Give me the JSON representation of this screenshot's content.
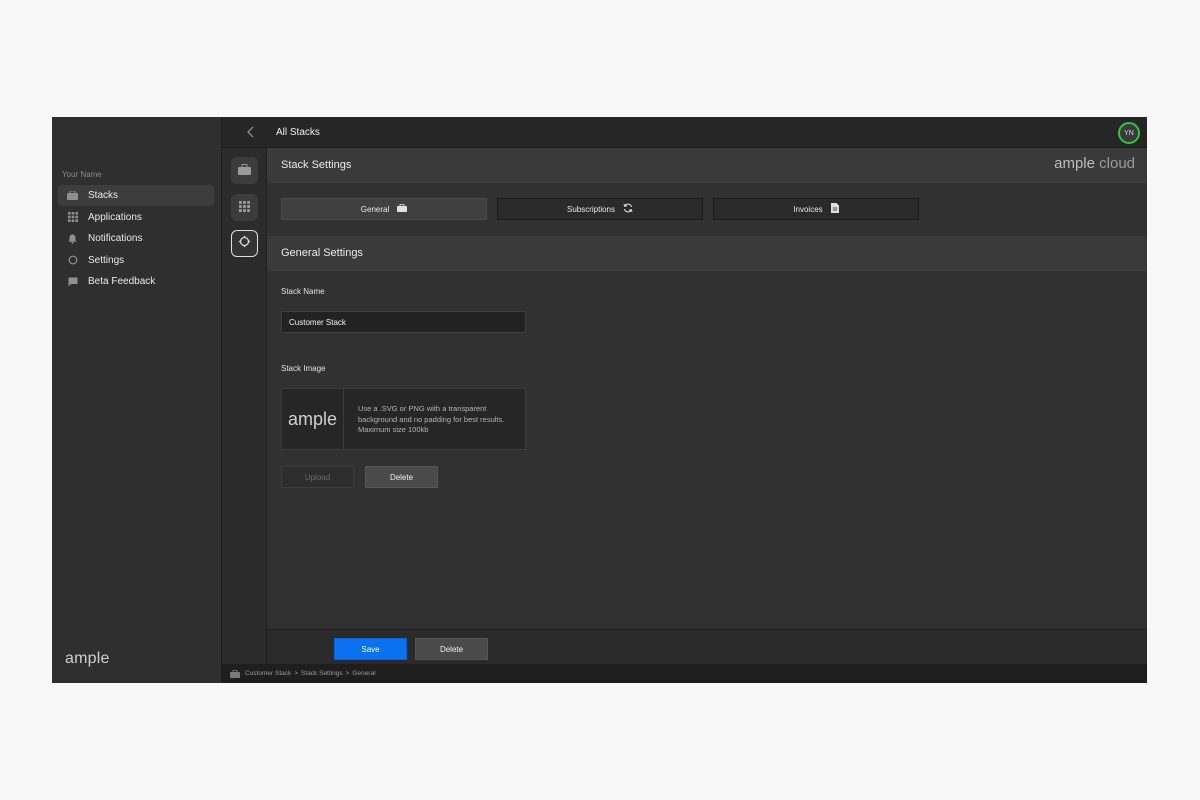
{
  "sidebar": {
    "user_name": "Your Name",
    "items": [
      {
        "label": "Stacks",
        "icon": "stack-icon",
        "active": true
      },
      {
        "label": "Applications",
        "icon": "grid-icon",
        "active": false
      },
      {
        "label": "Notifications",
        "icon": "bell-icon",
        "active": false
      },
      {
        "label": "Settings",
        "icon": "gear-icon",
        "active": false
      },
      {
        "label": "Beta Feedback",
        "icon": "chat-icon",
        "active": false
      }
    ],
    "brand": "ample"
  },
  "topbar": {
    "title": "All Stacks",
    "avatar_initials": "YN",
    "avatar_ring_color": "#2fc63b"
  },
  "header": {
    "title": "Stack Settings",
    "brand_left": "ample",
    "brand_right": "cloud"
  },
  "tabs": [
    {
      "label": "General",
      "icon": "briefcase-icon",
      "active": true
    },
    {
      "label": "Subscriptions",
      "icon": "refresh-icon",
      "active": false
    },
    {
      "label": "Invoices",
      "icon": "document-icon",
      "active": false
    }
  ],
  "general": {
    "section_title": "General Settings",
    "stack_name_label": "Stack Name",
    "stack_name_value": "Customer Stack",
    "stack_image_label": "Stack Image",
    "image_logo_text": "ample",
    "image_hint": "Use a .SVG or PNG with a transparent background and no padding for best results. Maximum size 100kb",
    "upload_label": "Upload",
    "delete_label": "Delete"
  },
  "footer": {
    "save_label": "Save",
    "delete_label": "Delete",
    "save_color": "#0a72f0"
  },
  "breadcrumb": {
    "items": [
      "Customer Stack",
      "Stack Settings",
      "General"
    ],
    "separator": ">"
  }
}
